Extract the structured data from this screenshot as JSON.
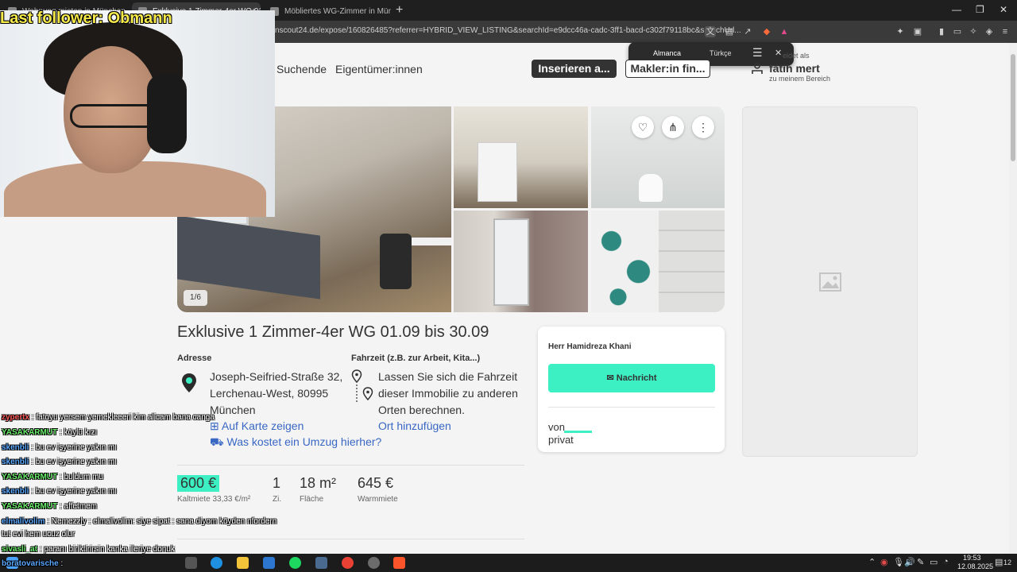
{
  "browser": {
    "tabs": [
      {
        "label": "Wohnung mieten in München - Imm"
      },
      {
        "label": "Exklusive 1 Zimmer-4er WG 01.0"
      },
      {
        "label": "Möbliertes WG-Zimmer in München"
      }
    ],
    "url": "nscout24.de/expose/160826485?referrer=HYBRID_VIEW_LISTING&searchId=e9dcc46a-cadc-3ff1-bacd-c302f79118bc&searchUrl..."
  },
  "translate_popup": {
    "source_lang": "Almanca",
    "target_lang": "Türkçe"
  },
  "header": {
    "nav_suchende": "Suchende",
    "nav_eigentuemer": "Eigentümer:innen",
    "btn_inserieren": "Inserieren a...",
    "btn_makler": "Makler:in fin...",
    "user_sub1": "eldet als",
    "user_name": "fatih mert",
    "user_sub2": "zu meinem Bereich"
  },
  "gallery": {
    "counter": "1/6"
  },
  "listing": {
    "title": "Exklusive 1 Zimmer-4er WG 01.09 bis 30.09",
    "address_label": "Adresse",
    "address_line1": "Joseph-Seifried-Straße 32,",
    "address_line2": "Lerchenau-West, 80995",
    "address_line3": "München",
    "map_link": "Auf Karte zeigen",
    "moving_link": "Was kostet ein Umzug hierher?",
    "commute_label": "Fahrzeit (z.B. zur Arbeit, Kita...)",
    "commute_line1": "Lassen Sie sich die Fahrzeit",
    "commute_line2": "dieser Immobilie zu anderen",
    "commute_line3": "Orten berechnen.",
    "add_location_link": "Ort hinzufügen"
  },
  "contact": {
    "name": "Herr Hamidreza Khani",
    "message_button": "Nachricht",
    "von": "von",
    "privat": "privat"
  },
  "facts": {
    "rent_value": "600 €",
    "rent_label": "Kaltmiete 33,33 €/m²",
    "rooms_value": "1",
    "rooms_label": "Zi.",
    "area_value": "18 m²",
    "area_label": "Fläche",
    "warm_value": "645 €",
    "warm_label": "Warmmiete"
  },
  "stream": {
    "last_follower": "Last follower: Obmann"
  },
  "chat": [
    {
      "user": "zypertx",
      "msg": ": fatoyu yersem yemekleeeri kim alicam bana canga",
      "color": "#ff5a5a"
    },
    {
      "user": "YASAKARMUT",
      "msg": ": köylü kızı",
      "color": "#6df06d"
    },
    {
      "user": "skenbli",
      "msg": ": bu ev işyerine yakın mı",
      "color": "#5aa8ff"
    },
    {
      "user": "skenbli",
      "msg": ": bu ev işyerine yakın mı",
      "color": "#5aa8ff"
    },
    {
      "user": "YASAKARMUT",
      "msg": ": buldum mu",
      "color": "#6df06d"
    },
    {
      "user": "skenbli",
      "msg": ": bu ev işyerine yakın mı",
      "color": "#5aa8ff"
    },
    {
      "user": "YASAKARMUT",
      "msg": ": affetmem",
      "color": "#6df06d"
    },
    {
      "user": "elmalivolim",
      "msg": ": Nemezzly : elmalivolim: siye sipat : sana diyom köyden nfordern",
      "color": "#5aa8ff"
    },
    {
      "user": "",
      "msg": "tut evi hem ucuz olur",
      "color": "#ffffff"
    },
    {
      "user": "sivasli_at",
      "msg": ": paranı biriktirirsin kanka ileriye donuk",
      "color": "#6df06d"
    },
    {
      "user": "boratovarische",
      "msg": ":",
      "color": "#5aa8ff"
    }
  ],
  "taskbar": {
    "time": "19:53",
    "date": "12.08.2025",
    "notif_count": "12"
  }
}
